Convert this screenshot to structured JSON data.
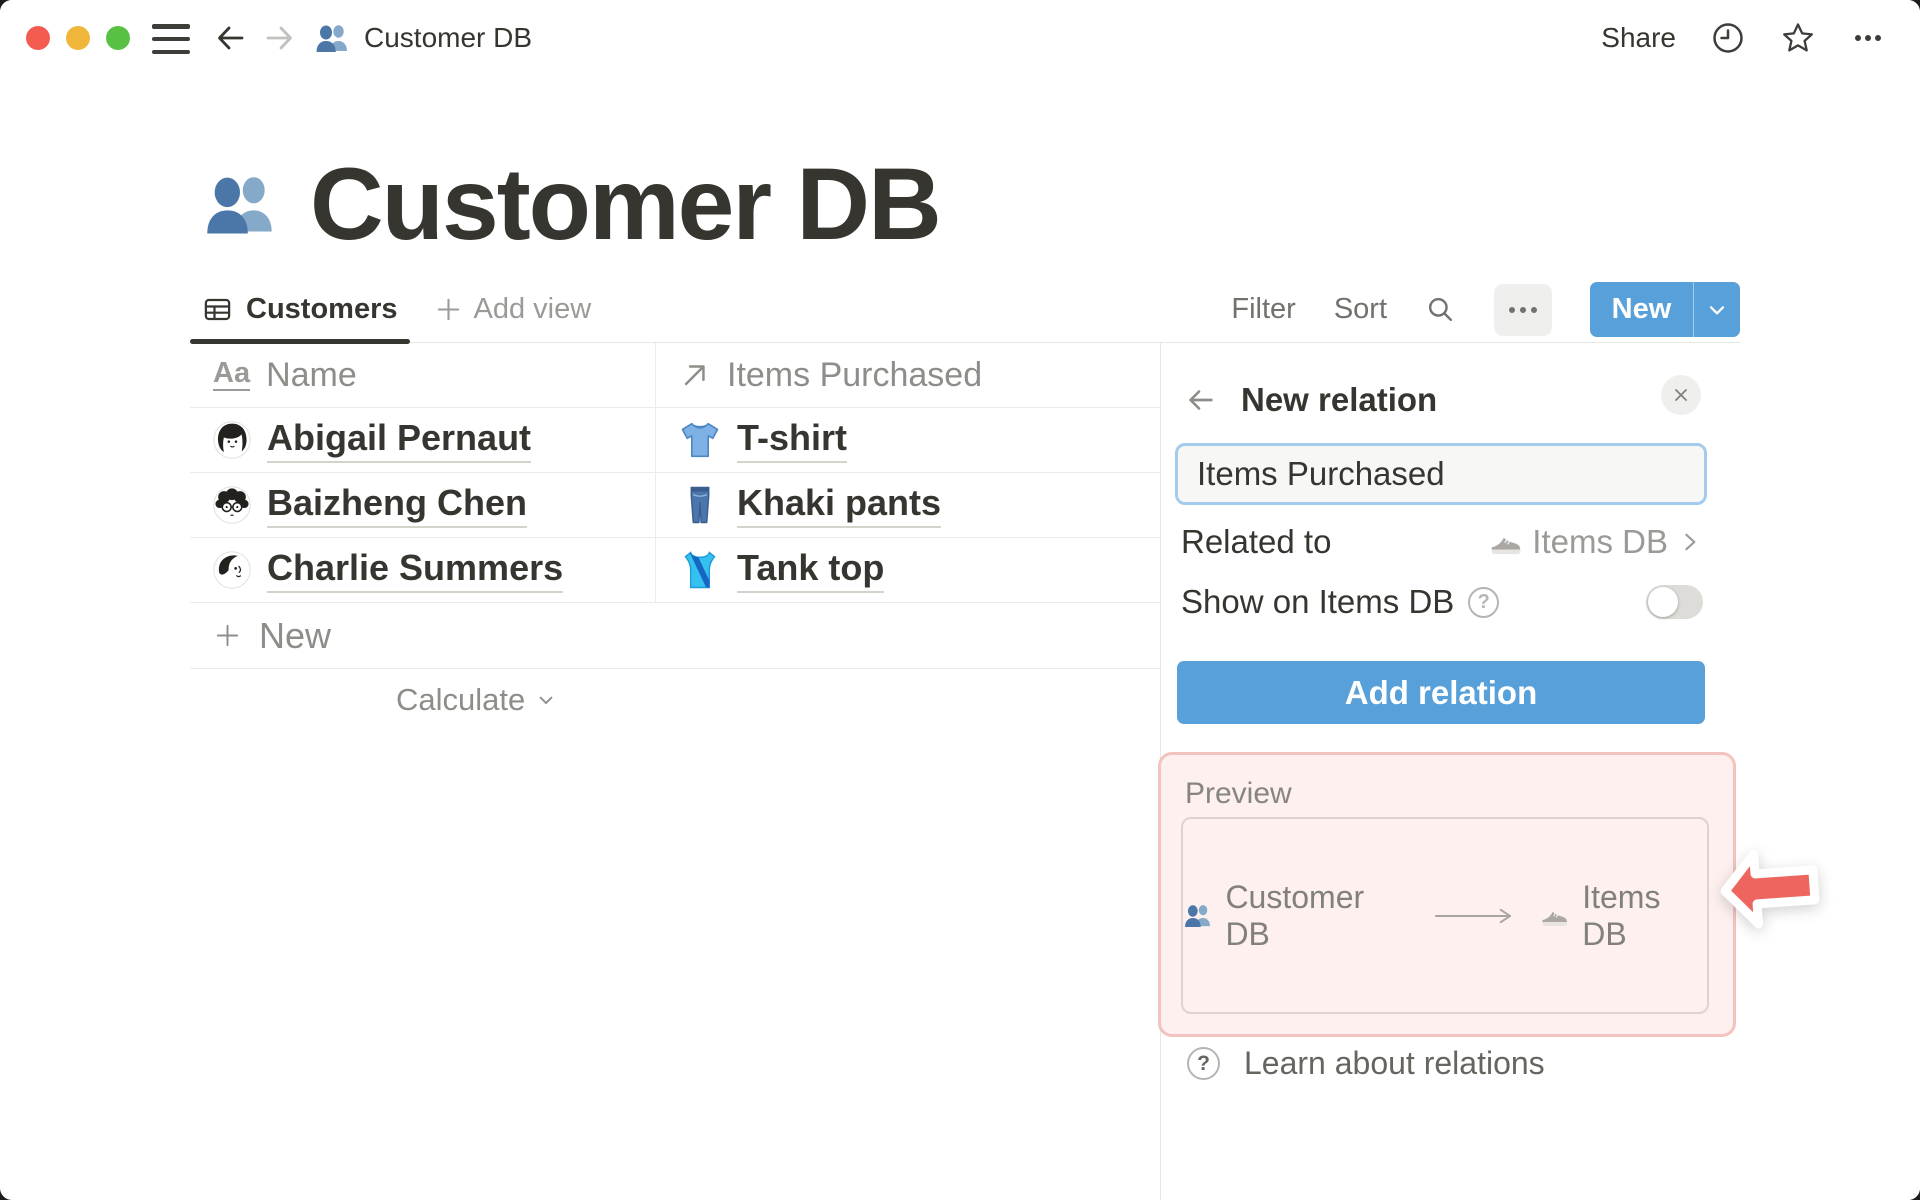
{
  "colors": {
    "accent_blue": "#57a0d9",
    "annotation_arrow_red": "#ed655e",
    "preview_bg": "#fdf0ef",
    "preview_border": "#f3c3bf",
    "traffic_red": "#f45c52",
    "traffic_yellow": "#f0b53b",
    "traffic_green": "#58c143"
  },
  "titlebar": {
    "doc_title": "Customer DB",
    "share_label": "Share"
  },
  "page": {
    "title": "Customer DB",
    "icon": "people-emoji"
  },
  "view_tabs": {
    "active_label": "Customers",
    "add_view_label": "Add view"
  },
  "view_controls": {
    "filter_label": "Filter",
    "sort_label": "Sort",
    "new_button_label": "New"
  },
  "table": {
    "columns": [
      {
        "type_glyph": "Aa",
        "label": "Name"
      },
      {
        "type_glyph": "relation-arrow",
        "label": "Items Purchased"
      }
    ],
    "rows": [
      {
        "avatar": "avatar-bob-haircut",
        "name": "Abigail Pernaut",
        "item_icon": "tshirt-emoji",
        "item": "T-shirt"
      },
      {
        "avatar": "avatar-curly-glasses",
        "name": "Baizheng Chen",
        "item_icon": "jeans-emoji",
        "item": "Khaki pants"
      },
      {
        "avatar": "avatar-profile-sketch",
        "name": "Charlie Summers",
        "item_icon": "tanktop-emoji",
        "item": "Tank top"
      }
    ],
    "new_row_label": "New",
    "calculate_label": "Calculate"
  },
  "relation_panel": {
    "title": "New relation",
    "name_input_value": "Items Purchased",
    "related_to": {
      "label": "Related to",
      "value": "Items DB",
      "value_icon": "sneaker-emoji"
    },
    "show_on": {
      "label": "Show on Items DB",
      "toggle_state": "off"
    },
    "add_button_label": "Add relation",
    "preview": {
      "label": "Preview",
      "source_label": "Customer DB",
      "source_icon": "people-emoji",
      "target_label": "Items DB",
      "target_icon": "sneaker-emoji"
    },
    "learn_label": "Learn about relations"
  }
}
